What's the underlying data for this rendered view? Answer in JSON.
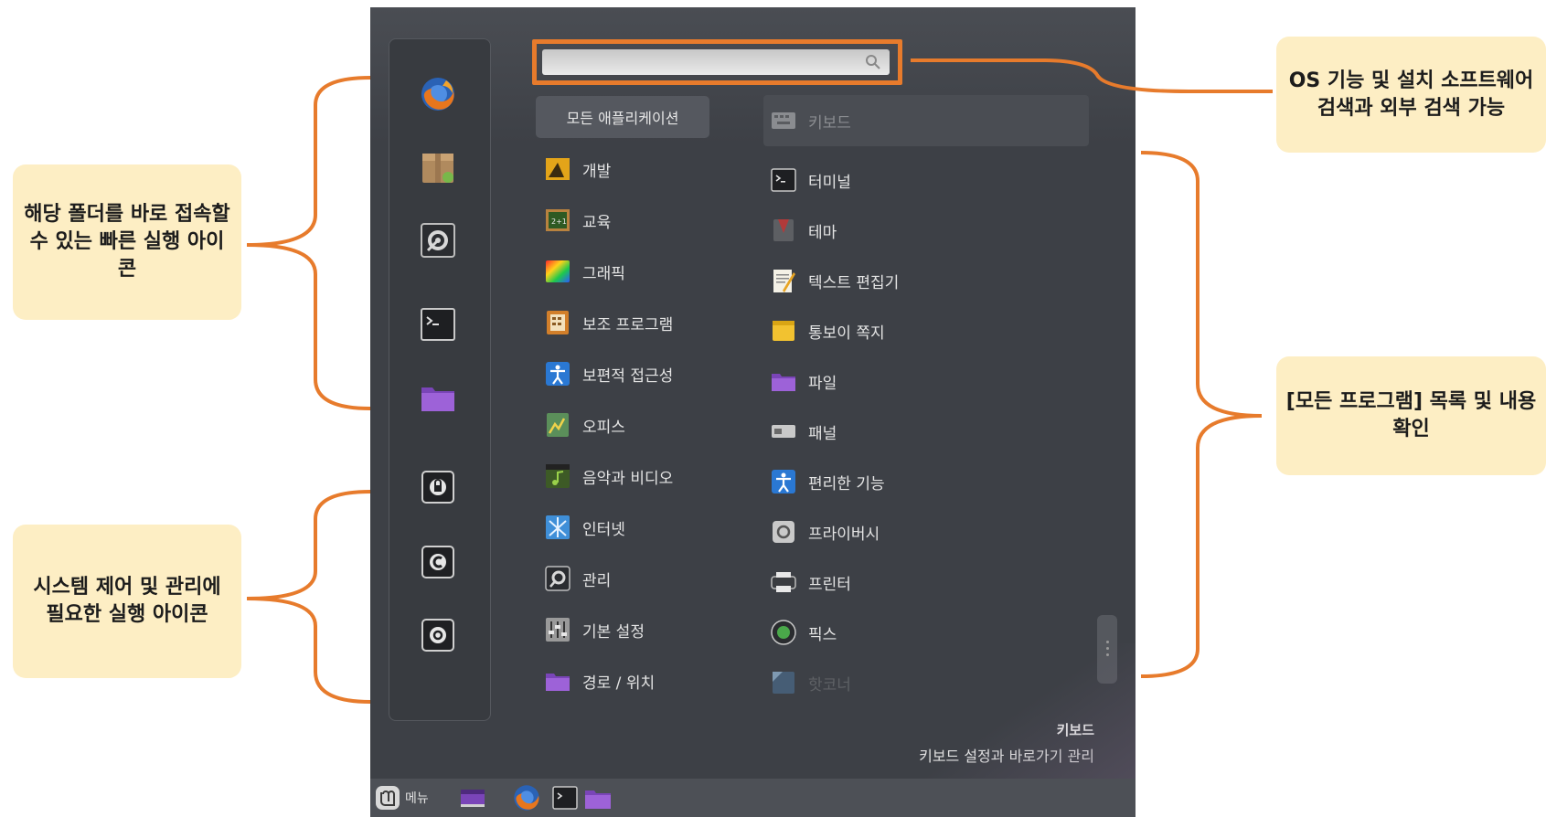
{
  "menu": {
    "search": {
      "value": "",
      "placeholder": ""
    },
    "all_apps_label": "모든 애플리케이션",
    "categories": [
      {
        "label": "개발",
        "icon": "development-icon"
      },
      {
        "label": "교육",
        "icon": "education-icon"
      },
      {
        "label": "그래픽",
        "icon": "graphics-icon"
      },
      {
        "label": "보조 프로그램",
        "icon": "accessories-icon"
      },
      {
        "label": "보편적 접근성",
        "icon": "accessibility-icon"
      },
      {
        "label": "오피스",
        "icon": "office-icon"
      },
      {
        "label": "음악과 비디오",
        "icon": "multimedia-icon"
      },
      {
        "label": "인터넷",
        "icon": "internet-icon"
      },
      {
        "label": "관리",
        "icon": "administration-icon"
      },
      {
        "label": "기본 설정",
        "icon": "preferences-icon"
      },
      {
        "label": "경로 / 위치",
        "icon": "places-folder-icon"
      }
    ],
    "apps": [
      {
        "label": "키보드",
        "icon": "keyboard-icon"
      },
      {
        "label": "터미널",
        "icon": "terminal-icon"
      },
      {
        "label": "테마",
        "icon": "theme-icon"
      },
      {
        "label": "텍스트 편집기",
        "icon": "text-editor-icon"
      },
      {
        "label": "통보이 쪽지",
        "icon": "tomboy-notes-icon"
      },
      {
        "label": "파일",
        "icon": "folder-icon"
      },
      {
        "label": "패널",
        "icon": "panel-icon"
      },
      {
        "label": "편리한 기능",
        "icon": "accessibility-icon"
      },
      {
        "label": "프라이버시",
        "icon": "privacy-icon"
      },
      {
        "label": "프린터",
        "icon": "printer-icon"
      },
      {
        "label": "픽스",
        "icon": "pix-icon"
      },
      {
        "label": "핫코너",
        "icon": "hot-corner-icon"
      }
    ],
    "description": {
      "title": "키보드",
      "text": "키보드 설정과 바로가기 관리"
    }
  },
  "favorites": [
    "firefox-icon",
    "package-manager-icon",
    "system-settings-icon",
    "terminal-icon",
    "folder-icon"
  ],
  "system_buttons": [
    "lock-screen-icon",
    "logout-icon",
    "power-icon"
  ],
  "taskbar": {
    "menu_label": "메뉴"
  },
  "callouts": {
    "quick_launch": "해당 폴더를 바로 접속할 수 있는 빠른 실행 아이콘",
    "system": "시스템 제어 및 관리에 필요한 실행 아이콘",
    "search": "OS 기능 및 설치 소프트웨어 검색과 외부 검색 가능",
    "programs": "[모든 프로그램] 목록 및 내용 확인"
  },
  "colors": {
    "accent": "#e77b2c",
    "callout_bg": "#fdeec4",
    "menu_bg": "#3d4046"
  }
}
